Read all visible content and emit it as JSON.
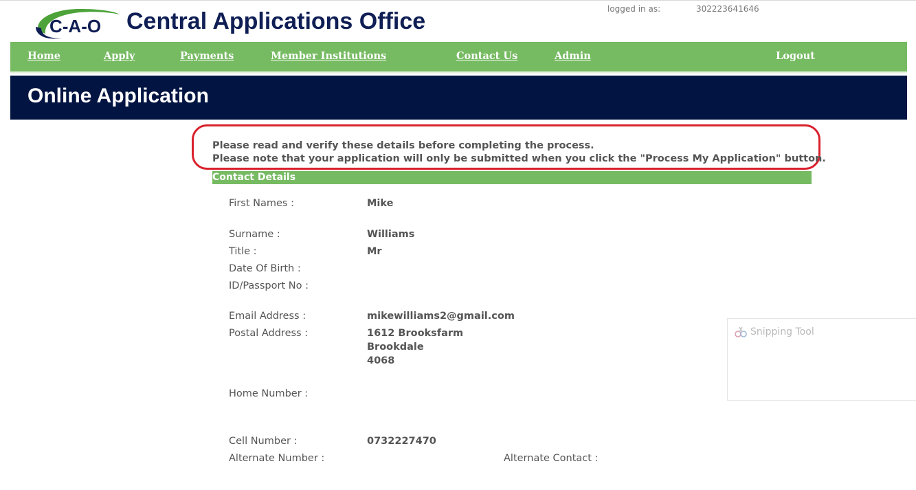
{
  "header": {
    "logo_text": "C-A-O",
    "title": "Central Applications Office",
    "login_label": "logged in as:",
    "login_id": "302223641646"
  },
  "nav": {
    "home": "Home",
    "apply": "Apply",
    "payments": "Payments",
    "member_institutions": "Member Institutions",
    "contact_us": "Contact Us",
    "admin": "Admin",
    "logout": "Logout"
  },
  "banner": {
    "title": "Online Application"
  },
  "notice": {
    "line1": "Please read and verify these details before completing the process.",
    "line2": "Please note that your application will only be submitted when you click the \"Process My Application\" button."
  },
  "contact_details": {
    "header": "Contact Details",
    "first_names": {
      "label": "First Names :",
      "value": "Mike"
    },
    "surname": {
      "label": "Surname :",
      "value": "Williams"
    },
    "title": {
      "label": "Title :",
      "value": "Mr"
    },
    "dob": {
      "label": "Date Of Birth :",
      "value": ""
    },
    "id_passport": {
      "label": "ID/Passport No :",
      "value": ""
    },
    "email": {
      "label": "Email Address :",
      "value": "mikewilliams2@gmail.com"
    },
    "postal": {
      "label": "Postal Address :",
      "line1": "1612 Brooksfarm",
      "line2": "Brookdale",
      "line3": "4068"
    },
    "home_number": {
      "label": "Home Number :",
      "value": ""
    },
    "cell_number": {
      "label": "Cell Number :",
      "value": "0732227470"
    },
    "alternate_number": {
      "label": "Alternate Number :",
      "value": ""
    },
    "alternate_contact": {
      "label": "Alternate Contact :",
      "value": ""
    }
  },
  "snipping_tool": {
    "title": "Snipping Tool"
  },
  "colors": {
    "nav_green": "#76ba62",
    "banner_navy": "#011442",
    "title_navy": "#0f1e54",
    "highlight_red": "#d9202c"
  }
}
